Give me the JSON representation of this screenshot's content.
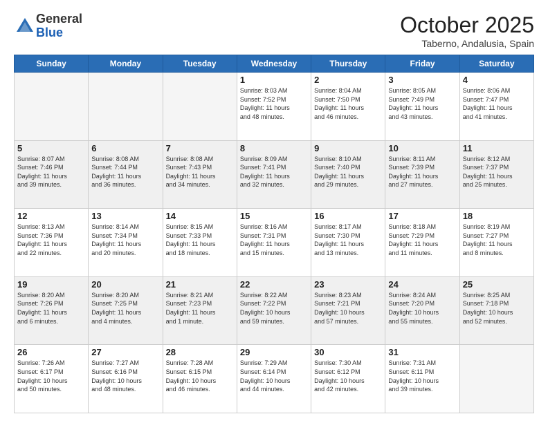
{
  "logo": {
    "general": "General",
    "blue": "Blue"
  },
  "header": {
    "month": "October 2025",
    "location": "Taberno, Andalusia, Spain"
  },
  "weekdays": [
    "Sunday",
    "Monday",
    "Tuesday",
    "Wednesday",
    "Thursday",
    "Friday",
    "Saturday"
  ],
  "weeks": [
    [
      {
        "day": "",
        "info": ""
      },
      {
        "day": "",
        "info": ""
      },
      {
        "day": "",
        "info": ""
      },
      {
        "day": "1",
        "info": "Sunrise: 8:03 AM\nSunset: 7:52 PM\nDaylight: 11 hours\nand 48 minutes."
      },
      {
        "day": "2",
        "info": "Sunrise: 8:04 AM\nSunset: 7:50 PM\nDaylight: 11 hours\nand 46 minutes."
      },
      {
        "day": "3",
        "info": "Sunrise: 8:05 AM\nSunset: 7:49 PM\nDaylight: 11 hours\nand 43 minutes."
      },
      {
        "day": "4",
        "info": "Sunrise: 8:06 AM\nSunset: 7:47 PM\nDaylight: 11 hours\nand 41 minutes."
      }
    ],
    [
      {
        "day": "5",
        "info": "Sunrise: 8:07 AM\nSunset: 7:46 PM\nDaylight: 11 hours\nand 39 minutes."
      },
      {
        "day": "6",
        "info": "Sunrise: 8:08 AM\nSunset: 7:44 PM\nDaylight: 11 hours\nand 36 minutes."
      },
      {
        "day": "7",
        "info": "Sunrise: 8:08 AM\nSunset: 7:43 PM\nDaylight: 11 hours\nand 34 minutes."
      },
      {
        "day": "8",
        "info": "Sunrise: 8:09 AM\nSunset: 7:41 PM\nDaylight: 11 hours\nand 32 minutes."
      },
      {
        "day": "9",
        "info": "Sunrise: 8:10 AM\nSunset: 7:40 PM\nDaylight: 11 hours\nand 29 minutes."
      },
      {
        "day": "10",
        "info": "Sunrise: 8:11 AM\nSunset: 7:39 PM\nDaylight: 11 hours\nand 27 minutes."
      },
      {
        "day": "11",
        "info": "Sunrise: 8:12 AM\nSunset: 7:37 PM\nDaylight: 11 hours\nand 25 minutes."
      }
    ],
    [
      {
        "day": "12",
        "info": "Sunrise: 8:13 AM\nSunset: 7:36 PM\nDaylight: 11 hours\nand 22 minutes."
      },
      {
        "day": "13",
        "info": "Sunrise: 8:14 AM\nSunset: 7:34 PM\nDaylight: 11 hours\nand 20 minutes."
      },
      {
        "day": "14",
        "info": "Sunrise: 8:15 AM\nSunset: 7:33 PM\nDaylight: 11 hours\nand 18 minutes."
      },
      {
        "day": "15",
        "info": "Sunrise: 8:16 AM\nSunset: 7:31 PM\nDaylight: 11 hours\nand 15 minutes."
      },
      {
        "day": "16",
        "info": "Sunrise: 8:17 AM\nSunset: 7:30 PM\nDaylight: 11 hours\nand 13 minutes."
      },
      {
        "day": "17",
        "info": "Sunrise: 8:18 AM\nSunset: 7:29 PM\nDaylight: 11 hours\nand 11 minutes."
      },
      {
        "day": "18",
        "info": "Sunrise: 8:19 AM\nSunset: 7:27 PM\nDaylight: 11 hours\nand 8 minutes."
      }
    ],
    [
      {
        "day": "19",
        "info": "Sunrise: 8:20 AM\nSunset: 7:26 PM\nDaylight: 11 hours\nand 6 minutes."
      },
      {
        "day": "20",
        "info": "Sunrise: 8:20 AM\nSunset: 7:25 PM\nDaylight: 11 hours\nand 4 minutes."
      },
      {
        "day": "21",
        "info": "Sunrise: 8:21 AM\nSunset: 7:23 PM\nDaylight: 11 hours\nand 1 minute."
      },
      {
        "day": "22",
        "info": "Sunrise: 8:22 AM\nSunset: 7:22 PM\nDaylight: 10 hours\nand 59 minutes."
      },
      {
        "day": "23",
        "info": "Sunrise: 8:23 AM\nSunset: 7:21 PM\nDaylight: 10 hours\nand 57 minutes."
      },
      {
        "day": "24",
        "info": "Sunrise: 8:24 AM\nSunset: 7:20 PM\nDaylight: 10 hours\nand 55 minutes."
      },
      {
        "day": "25",
        "info": "Sunrise: 8:25 AM\nSunset: 7:18 PM\nDaylight: 10 hours\nand 52 minutes."
      }
    ],
    [
      {
        "day": "26",
        "info": "Sunrise: 7:26 AM\nSunset: 6:17 PM\nDaylight: 10 hours\nand 50 minutes."
      },
      {
        "day": "27",
        "info": "Sunrise: 7:27 AM\nSunset: 6:16 PM\nDaylight: 10 hours\nand 48 minutes."
      },
      {
        "day": "28",
        "info": "Sunrise: 7:28 AM\nSunset: 6:15 PM\nDaylight: 10 hours\nand 46 minutes."
      },
      {
        "day": "29",
        "info": "Sunrise: 7:29 AM\nSunset: 6:14 PM\nDaylight: 10 hours\nand 44 minutes."
      },
      {
        "day": "30",
        "info": "Sunrise: 7:30 AM\nSunset: 6:12 PM\nDaylight: 10 hours\nand 42 minutes."
      },
      {
        "day": "31",
        "info": "Sunrise: 7:31 AM\nSunset: 6:11 PM\nDaylight: 10 hours\nand 39 minutes."
      },
      {
        "day": "",
        "info": ""
      }
    ]
  ]
}
